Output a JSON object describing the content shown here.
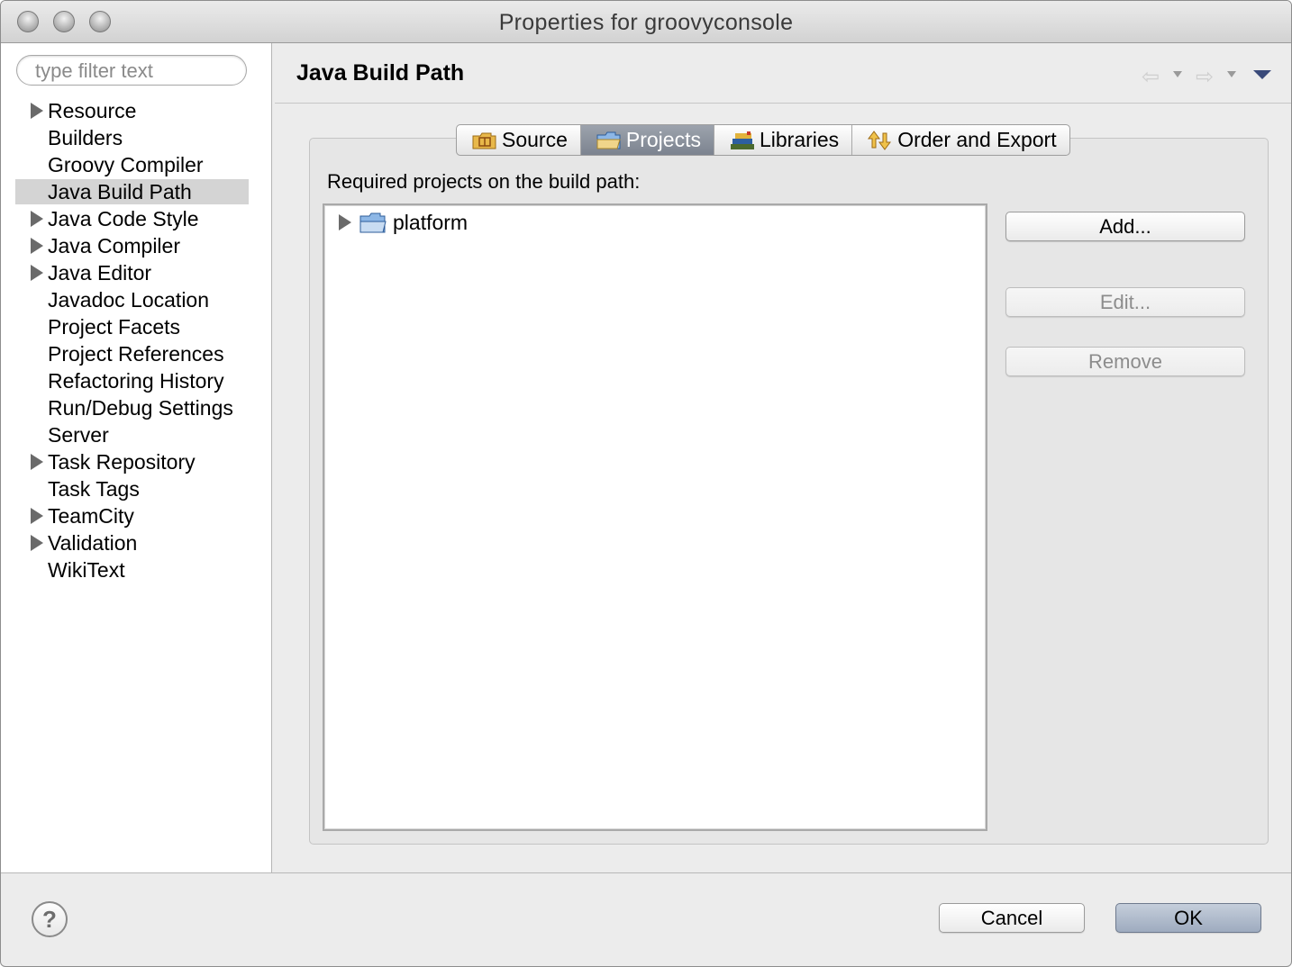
{
  "window": {
    "title": "Properties for groovyconsole"
  },
  "filter": {
    "placeholder": "type filter text"
  },
  "tree": {
    "items": [
      {
        "label": "Resource",
        "expandable": true
      },
      {
        "label": "Builders",
        "expandable": false
      },
      {
        "label": "Groovy Compiler",
        "expandable": false
      },
      {
        "label": "Java Build Path",
        "expandable": false,
        "selected": true
      },
      {
        "label": "Java Code Style",
        "expandable": true
      },
      {
        "label": "Java Compiler",
        "expandable": true
      },
      {
        "label": "Java Editor",
        "expandable": true
      },
      {
        "label": "Javadoc Location",
        "expandable": false
      },
      {
        "label": "Project Facets",
        "expandable": false
      },
      {
        "label": "Project References",
        "expandable": false
      },
      {
        "label": "Refactoring History",
        "expandable": false
      },
      {
        "label": "Run/Debug Settings",
        "expandable": false
      },
      {
        "label": "Server",
        "expandable": false
      },
      {
        "label": "Task Repository",
        "expandable": true
      },
      {
        "label": "Task Tags",
        "expandable": false
      },
      {
        "label": "TeamCity",
        "expandable": true
      },
      {
        "label": "Validation",
        "expandable": true
      },
      {
        "label": "WikiText",
        "expandable": false
      }
    ]
  },
  "page": {
    "title": "Java Build Path"
  },
  "nav": {
    "back_icon": "back-arrow-icon",
    "forward_icon": "forward-arrow-icon",
    "menu_icon": "view-menu-icon"
  },
  "tabs": [
    {
      "label": "Source",
      "icon": "source-folder-icon",
      "active": false
    },
    {
      "label": "Projects",
      "icon": "project-folder-icon",
      "active": true
    },
    {
      "label": "Libraries",
      "icon": "libraries-icon",
      "active": false
    },
    {
      "label": "Order and Export",
      "icon": "order-export-icon",
      "active": false
    }
  ],
  "projects": {
    "label": "Required projects on the build path:",
    "items": [
      {
        "label": "platform"
      }
    ],
    "buttons": {
      "add": "Add...",
      "edit": "Edit...",
      "remove": "Remove"
    }
  },
  "footer": {
    "help_icon": "help-icon",
    "help": "?",
    "cancel": "Cancel",
    "ok": "OK"
  }
}
